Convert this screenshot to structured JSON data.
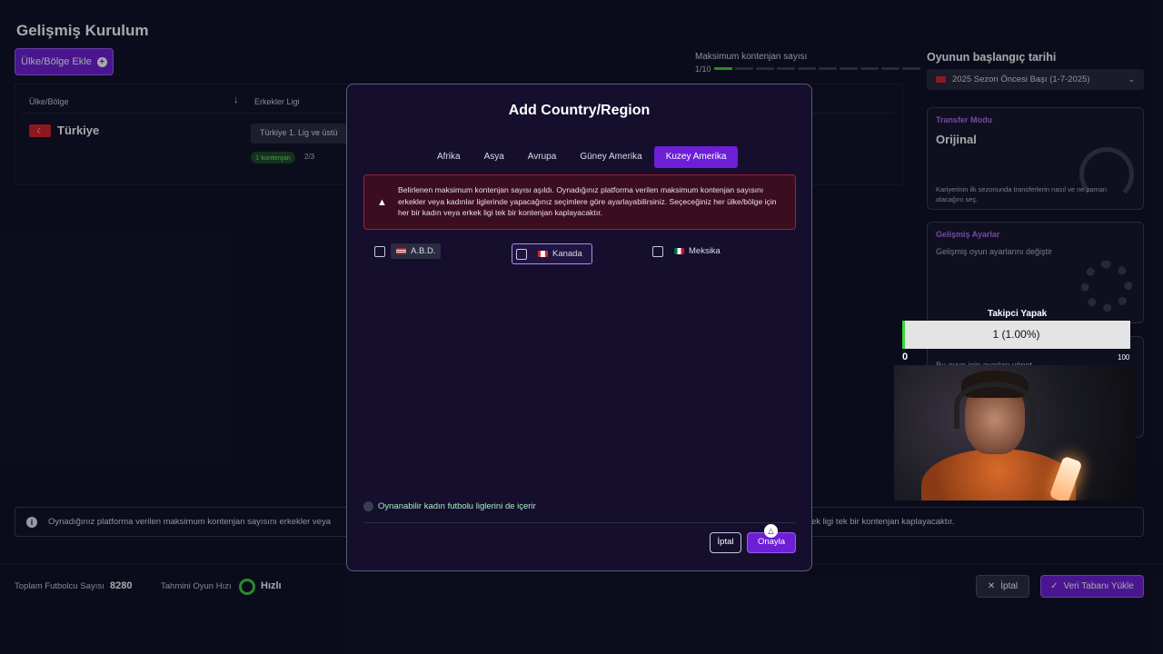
{
  "page": {
    "title": "Gelişmiş Kurulum",
    "add_country_label": "Ülke/Bölge Ekle"
  },
  "quota": {
    "label": "Maksimum kontenjan sayısı",
    "count": "1/10",
    "used": 1,
    "max": 10
  },
  "table": {
    "col_country": "Ülke/Bölge",
    "col_league": "Erkekler Ligi",
    "rows": [
      {
        "country": "Türkiye",
        "league": "Türkiye 1. Lig ve üstü",
        "chip": "1 kontenjan",
        "fraction": "2/3"
      }
    ]
  },
  "right_panel": {
    "start_date_title": "Oyunun başlangıç tarihi",
    "start_date_value": "2025 Sezon Öncesi Başı (1-7-2025)",
    "transfer_kicker": "Transfer Modu",
    "transfer_title": "Orijinal",
    "transfer_desc": "Kariyerinin ilk sezonunda transferlerin nasıl ve ne zaman olacağını seç.",
    "advanced_kicker": "Gelişmiş Ayarlar",
    "advanced_desc": "Gelişmiş oyun ayarlarını değiştir",
    "third_desc": "Bu oyun için ayarları yönet"
  },
  "info_bar": {
    "text_left": "Oynadığınız platforma verilen maksimum kontenjan sayısını erkekler veya",
    "text_right": "ek ligi tek bir kontenjan kaplayacaktır."
  },
  "footer": {
    "total_label": "Toplam Futbolcu Sayısı",
    "total_value": "8280",
    "speed_label": "Tahmini Oyun Hızı",
    "speed_value": "Hızlı",
    "cancel_label": "İptal",
    "load_label": "Veri Tabanı Yükle"
  },
  "modal": {
    "title": "Add Country/Region",
    "tabs": [
      "Afrika",
      "Asya",
      "Avrupa",
      "Güney Amerika",
      "Kuzey Amerika"
    ],
    "active_tab": "Kuzey Amerika",
    "warning": "Belirlenen maksimum kontenjan sayısı aşıldı. Oynadığınız platforma verilen maksimum kontenjan sayısını erkekler veya kadınlar liglerinde yapacağınız seçimlere göre ayarlayabilirsiniz. Seçeceğiniz her ülke/bölge için her bir kadın veya erkek ligi tek bir kontenjan kaplayacaktır.",
    "options": [
      {
        "label": "A.B.D.",
        "checked": false,
        "focused": false
      },
      {
        "label": "Kanada",
        "checked": false,
        "focused": true
      },
      {
        "label": "Meksika",
        "checked": false,
        "focused": false
      }
    ],
    "women_toggle_label": "Oynanabilir kadın futbolu liglerini de içerir",
    "cancel_label": "İptal",
    "confirm_label": "Onayla"
  },
  "overlay": {
    "follow_title": "Takipci Yapak",
    "follow_value": "1 (1.00%)",
    "follow_fraction": 0.01,
    "follow_min": "0",
    "follow_max": "100"
  },
  "colors": {
    "accent": "#6d1fd6",
    "success": "#3ad63a",
    "danger": "#9b2338"
  }
}
